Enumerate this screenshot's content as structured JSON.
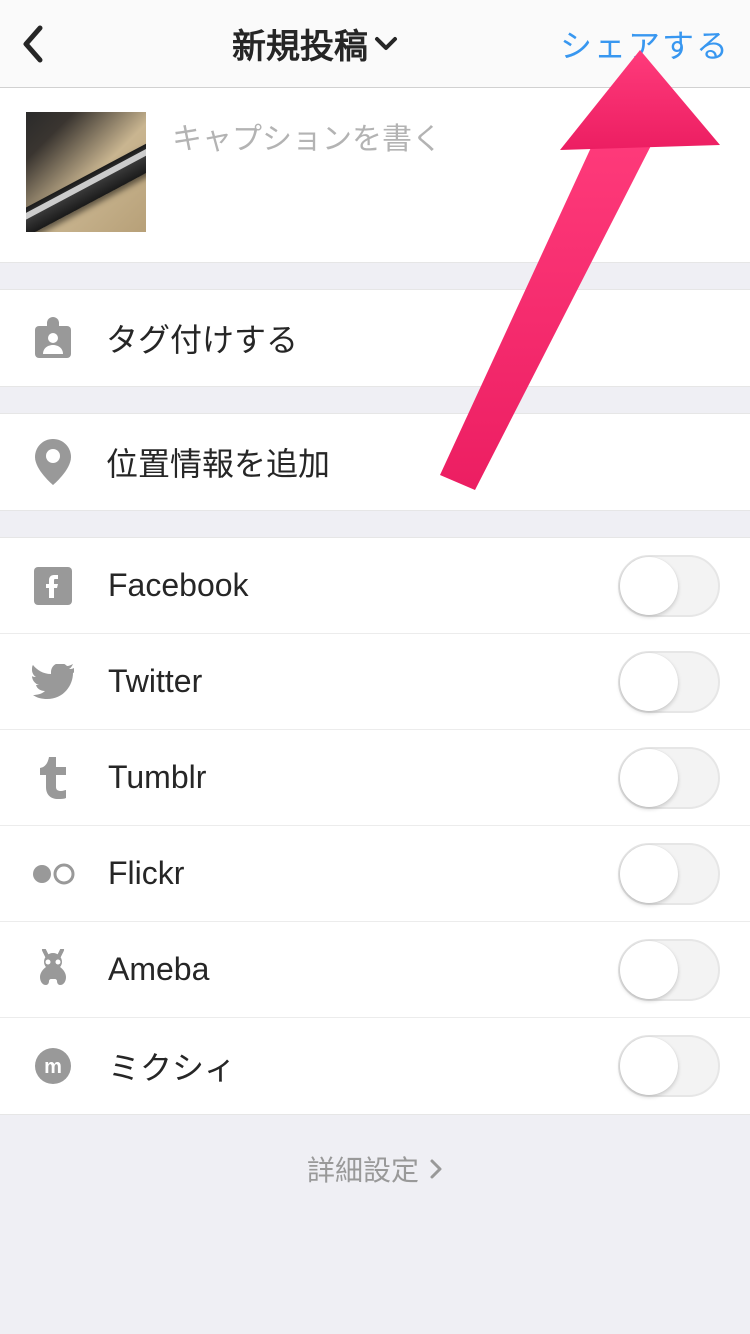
{
  "header": {
    "title": "新規投稿",
    "share_label": "シェアする"
  },
  "caption": {
    "placeholder": "キャプションを書く"
  },
  "rows": {
    "tag_label": "タグ付けする",
    "location_label": "位置情報を追加"
  },
  "share_services": [
    {
      "name": "Facebook",
      "icon": "facebook",
      "on": false
    },
    {
      "name": "Twitter",
      "icon": "twitter",
      "on": false
    },
    {
      "name": "Tumblr",
      "icon": "tumblr",
      "on": false
    },
    {
      "name": "Flickr",
      "icon": "flickr",
      "on": false
    },
    {
      "name": "Ameba",
      "icon": "ameba",
      "on": false
    },
    {
      "name": "ミクシィ",
      "icon": "mixi",
      "on": false
    }
  ],
  "advanced_label": "詳細設定",
  "colors": {
    "accent": "#3897f0",
    "annotation": "#ec1e62"
  }
}
